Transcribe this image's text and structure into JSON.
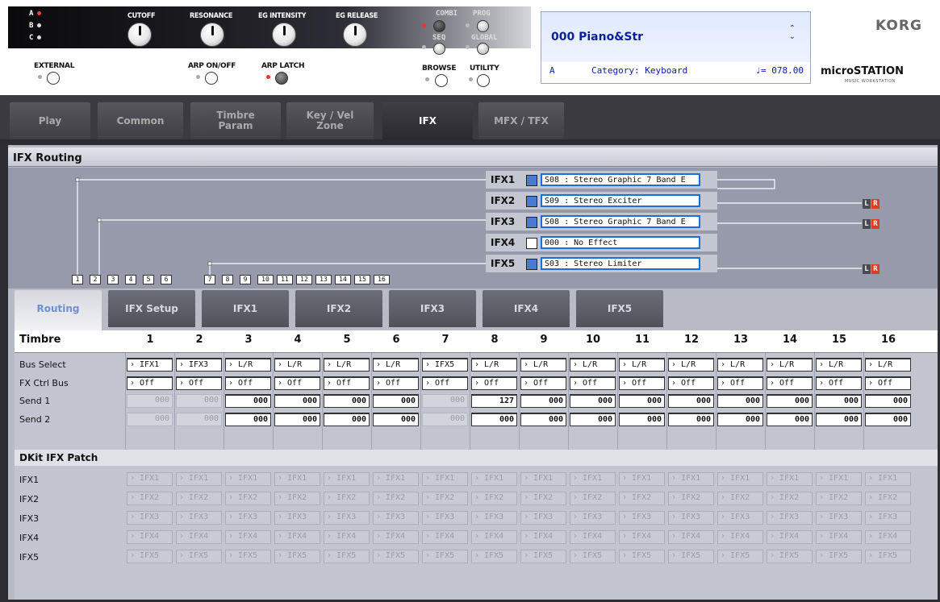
{
  "panel": {
    "bank_leds": [
      {
        "letter": "A",
        "red": true
      },
      {
        "letter": "B",
        "red": false
      },
      {
        "letter": "C",
        "red": false
      }
    ],
    "knobs": [
      "CUTOFF",
      "RESONANCE",
      "EG INTENSITY",
      "EG RELEASE"
    ],
    "modes": {
      "combi": "COMBI",
      "prog": "PROG",
      "seq": "SEQ",
      "global": "GLOBAL",
      "browse": "BROWSE",
      "utility": "UTILITY"
    },
    "external": "EXTERNAL",
    "arp_onoff": "ARP ON/OFF",
    "arp_latch": "ARP LATCH",
    "brand": "KORG",
    "product": "microSTATION",
    "product_sub": "MUSIC WORKSTATION"
  },
  "lcd": {
    "program_name": "000 Piano&Str",
    "bank": "A",
    "category": "Category: Keyboard",
    "tempo": "♩= 078.00"
  },
  "main_tabs": [
    {
      "label": "Play",
      "active": false
    },
    {
      "label": "Common",
      "active": false
    },
    {
      "label": "Timbre\nParam",
      "active": false
    },
    {
      "label": "Key / Vel\nZone",
      "active": false
    },
    {
      "label": "IFX",
      "active": true
    },
    {
      "label": "MFX / TFX",
      "active": false
    }
  ],
  "routing": {
    "title": "IFX Routing",
    "ifx": [
      {
        "label": "IFX1",
        "on": true,
        "effect": "S08 : Stereo Graphic 7 Band E"
      },
      {
        "label": "IFX2",
        "on": true,
        "effect": "S09 : Stereo Exciter"
      },
      {
        "label": "IFX3",
        "on": true,
        "effect": "S08 : Stereo Graphic 7 Band E"
      },
      {
        "label": "IFX4",
        "on": false,
        "effect": "000 : No Effect"
      },
      {
        "label": "IFX5",
        "on": true,
        "effect": "S03 : Stereo Limiter"
      }
    ],
    "output_l": "L",
    "output_r": "R",
    "timbres": [
      "1",
      "2",
      "3",
      "4",
      "5",
      "6",
      "7",
      "8",
      "9",
      "10",
      "11",
      "12",
      "13",
      "14",
      "15",
      "16"
    ]
  },
  "sub_tabs": [
    {
      "label": "Routing",
      "active": true
    },
    {
      "label": "IFX Setup",
      "active": false
    },
    {
      "label": "IFX1",
      "active": false
    },
    {
      "label": "IFX2",
      "active": false
    },
    {
      "label": "IFX3",
      "active": false
    },
    {
      "label": "IFX4",
      "active": false
    },
    {
      "label": "IFX5",
      "active": false
    }
  ],
  "table": {
    "header": "Timbre",
    "columns": [
      "1",
      "2",
      "3",
      "4",
      "5",
      "6",
      "7",
      "8",
      "9",
      "10",
      "11",
      "12",
      "13",
      "14",
      "15",
      "16"
    ],
    "rows": {
      "bus_select": {
        "label": "Bus Select",
        "values": [
          "IFX1",
          "IFX3",
          "L/R",
          "L/R",
          "L/R",
          "L/R",
          "IFX5",
          "L/R",
          "L/R",
          "L/R",
          "L/R",
          "L/R",
          "L/R",
          "L/R",
          "L/R",
          "L/R"
        ]
      },
      "fx_ctrl_bus": {
        "label": "FX Ctrl Bus",
        "values": [
          "Off",
          "Off",
          "Off",
          "Off",
          "Off",
          "Off",
          "Off",
          "Off",
          "Off",
          "Off",
          "Off",
          "Off",
          "Off",
          "Off",
          "Off",
          "Off"
        ]
      },
      "send1": {
        "label": "Send 1",
        "values": [
          "000",
          "000",
          "000",
          "000",
          "000",
          "000",
          "000",
          "127",
          "000",
          "000",
          "000",
          "000",
          "000",
          "000",
          "000",
          "000"
        ],
        "dim": [
          true,
          true,
          false,
          false,
          false,
          false,
          true,
          false,
          false,
          false,
          false,
          false,
          false,
          false,
          false,
          false
        ]
      },
      "send2": {
        "label": "Send 2",
        "values": [
          "000",
          "000",
          "000",
          "000",
          "000",
          "000",
          "000",
          "000",
          "000",
          "000",
          "000",
          "000",
          "000",
          "000",
          "000",
          "000"
        ],
        "dim": [
          true,
          true,
          false,
          false,
          false,
          false,
          true,
          false,
          false,
          false,
          false,
          false,
          false,
          false,
          false,
          false
        ]
      }
    },
    "dkit_header": "DKit IFX Patch",
    "dkit_rows": [
      {
        "label": "IFX1",
        "value": "IFX1"
      },
      {
        "label": "IFX2",
        "value": "IFX2"
      },
      {
        "label": "IFX3",
        "value": "IFX3"
      },
      {
        "label": "IFX4",
        "value": "IFX4"
      },
      {
        "label": "IFX5",
        "value": "IFX5"
      }
    ]
  },
  "colors": {
    "accent": "#1a6fd6",
    "led_red": "#ff3b3b",
    "output_r": "#e23a24",
    "lcd_text": "#0b1e9c"
  }
}
